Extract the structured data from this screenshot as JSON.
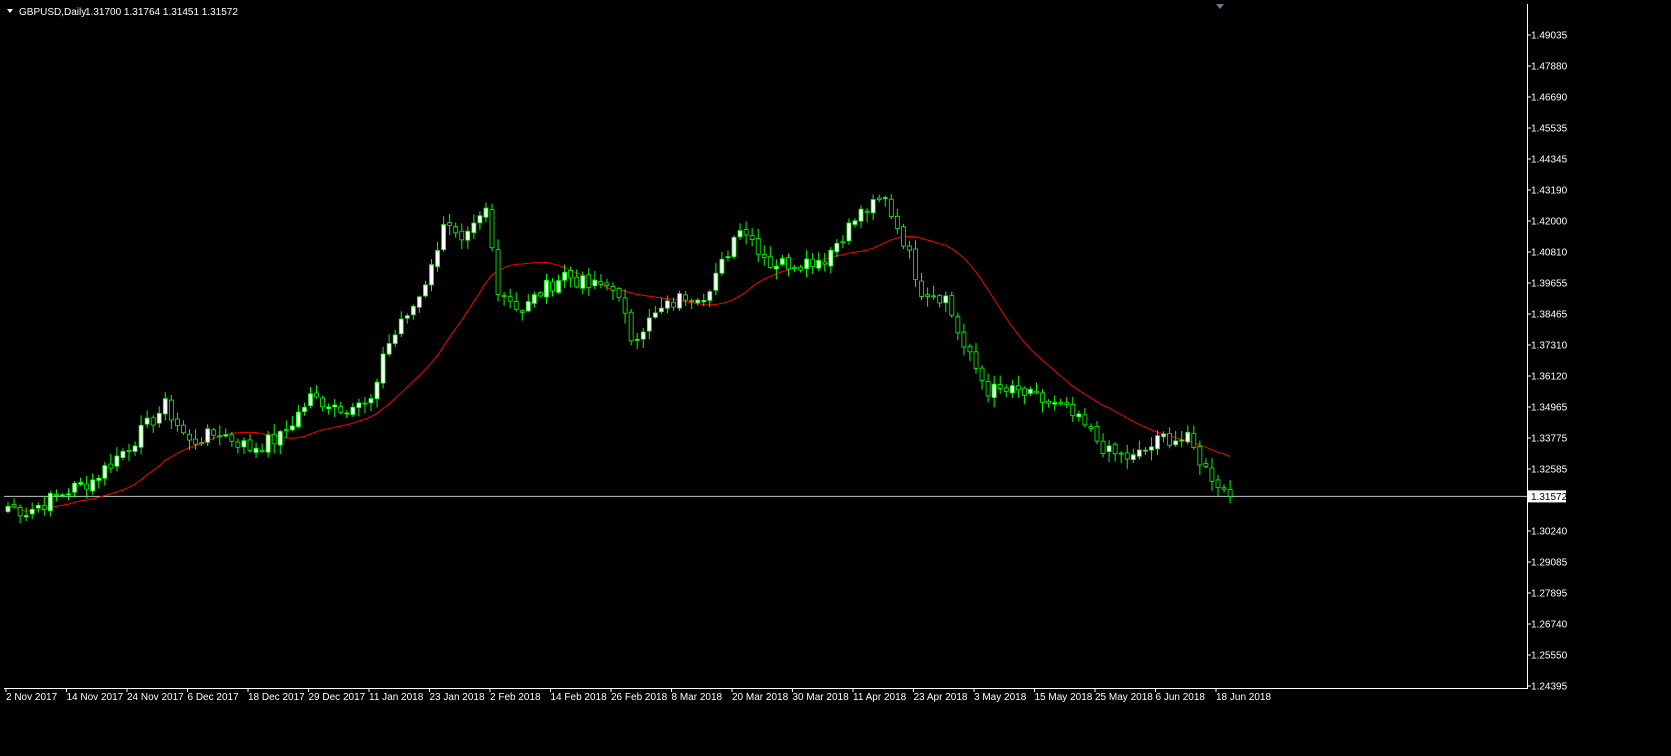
{
  "header": {
    "symbol": "GBPUSD,Daily",
    "ohlc": "1.31700 1.31764 1.31451 1.31572"
  },
  "current_price_label": "1.31572",
  "colors": {
    "background": "#000000",
    "bull_candle": "#ffffff",
    "bear_candle": "#000000",
    "wick": "#00ff00",
    "moving_average": "#ff0000",
    "price_line": "#c0c0c0",
    "text": "#ffffff"
  },
  "icons": {
    "symbol_menu": "triangle-down-icon",
    "shift_marker": "triangle-down-icon"
  },
  "chart_data": {
    "type": "candlestick",
    "title": "GBPUSD,Daily",
    "ylim": [
      1.24395,
      1.5
    ],
    "grid": false,
    "y_ticks": [
      "1.49035",
      "1.47880",
      "1.46690",
      "1.45535",
      "1.44345",
      "1.43190",
      "1.42000",
      "1.40810",
      "1.39655",
      "1.38465",
      "1.37310",
      "1.36120",
      "1.34965",
      "1.33775",
      "1.32585",
      "1.31572",
      "1.30240",
      "1.29085",
      "1.27895",
      "1.26740",
      "1.25550",
      "1.24395"
    ],
    "x_ticks": [
      "2 Nov 2017",
      "14 Nov 2017",
      "24 Nov 2017",
      "6 Dec 2017",
      "18 Dec 2017",
      "29 Dec 2017",
      "11 Jan 2018",
      "23 Jan 2018",
      "2 Feb 2018",
      "14 Feb 2018",
      "26 Feb 2018",
      "8 Mar 2018",
      "20 Mar 2018",
      "30 Mar 2018",
      "11 Apr 2018",
      "23 Apr 2018",
      "3 May 2018",
      "15 May 2018",
      "25 May 2018",
      "6 Jun 2018",
      "18 Jun 2018"
    ],
    "x_tick_index": [
      0,
      10,
      20,
      30,
      40,
      50,
      60,
      70,
      80,
      90,
      100,
      110,
      120,
      130,
      140,
      150,
      160,
      170,
      180,
      190,
      200
    ],
    "current_price": 1.31572,
    "key_points": [
      {
        "i": 0,
        "c": 1.312
      },
      {
        "i": 3,
        "c": 1.31
      },
      {
        "i": 10,
        "c": 1.318
      },
      {
        "i": 14,
        "c": 1.322
      },
      {
        "i": 20,
        "c": 1.335
      },
      {
        "i": 26,
        "c": 1.35
      },
      {
        "i": 30,
        "c": 1.336
      },
      {
        "i": 35,
        "c": 1.34
      },
      {
        "i": 40,
        "c": 1.334
      },
      {
        "i": 45,
        "c": 1.338
      },
      {
        "i": 50,
        "c": 1.353
      },
      {
        "i": 55,
        "c": 1.35
      },
      {
        "i": 60,
        "c": 1.35
      },
      {
        "i": 62,
        "c": 1.37
      },
      {
        "i": 67,
        "c": 1.388
      },
      {
        "i": 70,
        "c": 1.402
      },
      {
        "i": 72,
        "c": 1.42
      },
      {
        "i": 75,
        "c": 1.41
      },
      {
        "i": 79,
        "c": 1.424
      },
      {
        "i": 81,
        "c": 1.395
      },
      {
        "i": 85,
        "c": 1.386
      },
      {
        "i": 88,
        "c": 1.393
      },
      {
        "i": 92,
        "c": 1.4
      },
      {
        "i": 96,
        "c": 1.395
      },
      {
        "i": 100,
        "c": 1.396
      },
      {
        "i": 103,
        "c": 1.376
      },
      {
        "i": 108,
        "c": 1.386
      },
      {
        "i": 112,
        "c": 1.392
      },
      {
        "i": 116,
        "c": 1.393
      },
      {
        "i": 121,
        "c": 1.419
      },
      {
        "i": 126,
        "c": 1.404
      },
      {
        "i": 130,
        "c": 1.404
      },
      {
        "i": 135,
        "c": 1.406
      },
      {
        "i": 138,
        "c": 1.415
      },
      {
        "i": 141,
        "c": 1.423
      },
      {
        "i": 145,
        "c": 1.428
      },
      {
        "i": 148,
        "c": 1.413
      },
      {
        "i": 151,
        "c": 1.394
      },
      {
        "i": 155,
        "c": 1.391
      },
      {
        "i": 158,
        "c": 1.372
      },
      {
        "i": 162,
        "c": 1.356
      },
      {
        "i": 167,
        "c": 1.355
      },
      {
        "i": 172,
        "c": 1.351
      },
      {
        "i": 175,
        "c": 1.348
      },
      {
        "i": 178,
        "c": 1.342
      },
      {
        "i": 182,
        "c": 1.332
      },
      {
        "i": 186,
        "c": 1.33
      },
      {
        "i": 191,
        "c": 1.338
      },
      {
        "i": 195,
        "c": 1.337
      },
      {
        "i": 198,
        "c": 1.326
      },
      {
        "i": 202,
        "c": 1.3157
      }
    ]
  }
}
